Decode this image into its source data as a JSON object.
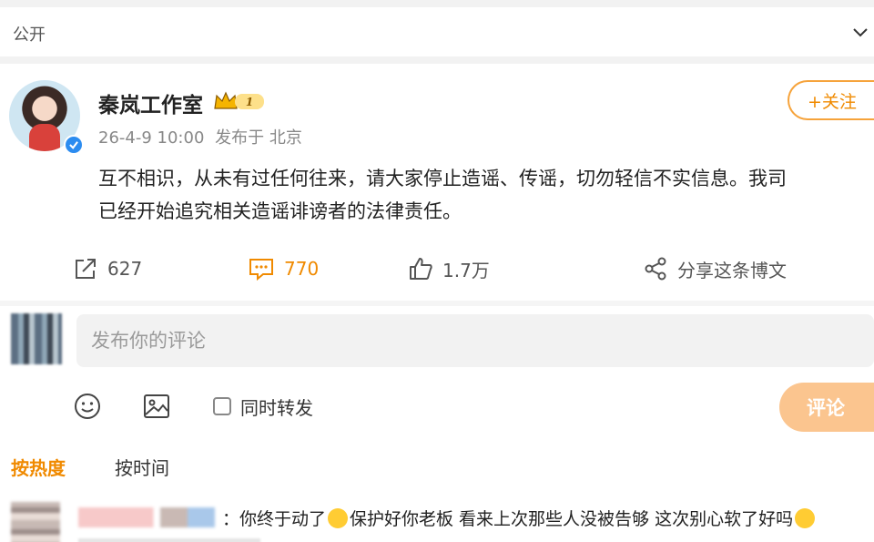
{
  "visibility": {
    "label": "公开"
  },
  "post": {
    "author": "秦岚工作室",
    "vip_level": "1",
    "date": "26-4-9 10:00",
    "source": "发布于 北京",
    "follow_label": "+关注",
    "text_line1": "互不相识，从未有过任何往来，请大家停止造谣、传谣，切勿轻信不实信息。我司",
    "text_line2": "已经开始追究相关造谣诽谤者的法律责任。"
  },
  "actions": {
    "repost_count": "627",
    "comment_count": "770",
    "like_count": "1.7万",
    "share_label": "分享这条博文"
  },
  "composer": {
    "placeholder": "发布你的评论",
    "repost_label": "同时转发",
    "submit_label": "评论"
  },
  "sort": {
    "hot": "按热度",
    "time": "按时间"
  },
  "comments": [
    {
      "text_a": "：你终于动了",
      "text_b": "保护好你老板  看来上次那些人没被告够  这次别心软了好吗"
    }
  ],
  "colors": {
    "accent": "#f08a00",
    "submit_disabled": "#fbc58f",
    "verified": "#2c8cf0"
  }
}
